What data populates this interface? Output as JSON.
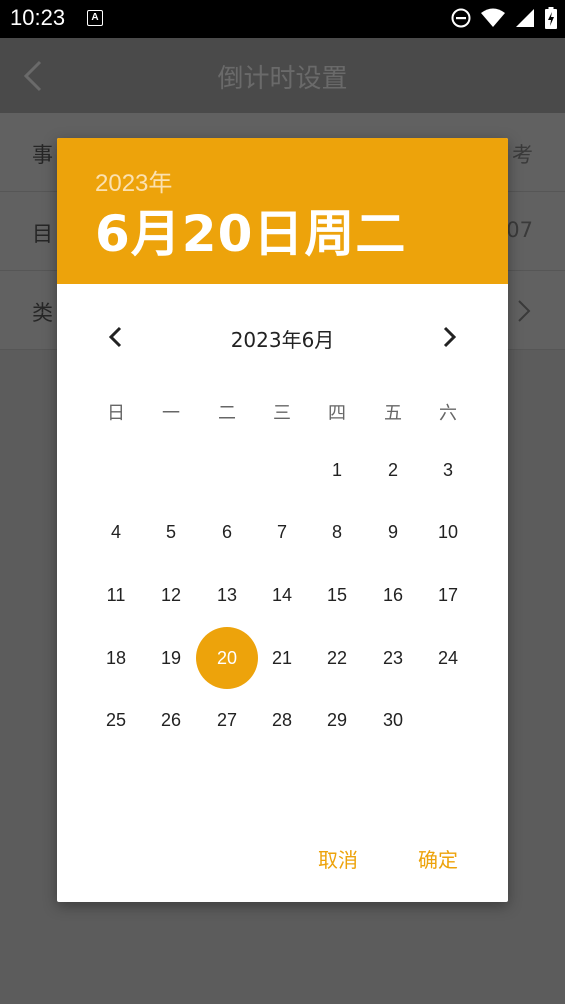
{
  "status": {
    "time": "10:23",
    "a_icon": "A"
  },
  "appbar": {
    "title": "倒计时设置"
  },
  "rows": [
    {
      "label": "事",
      "value": "考"
    },
    {
      "label": "目",
      "value": "07"
    },
    {
      "label": "类",
      "value": ""
    }
  ],
  "dialog": {
    "header_year": "2023年",
    "header_date": "6月20日周二",
    "month_title": "2023年6月",
    "weekdays": [
      "日",
      "一",
      "二",
      "三",
      "四",
      "五",
      "六"
    ],
    "first_weekday_index": 4,
    "days_in_month": 30,
    "selected_day": 20,
    "cancel_label": "取消",
    "confirm_label": "确定"
  },
  "colors": {
    "accent": "#eda30b"
  }
}
